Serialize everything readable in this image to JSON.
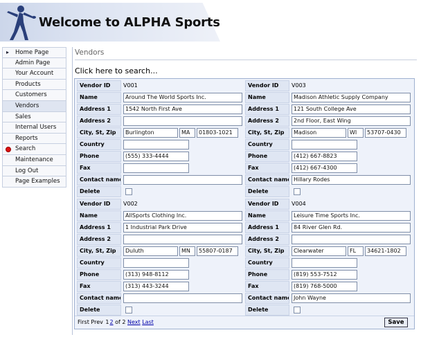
{
  "header": {
    "title_pre": "Welcome to ",
    "title_brand": "ALPHA",
    "title_post": " Sports"
  },
  "sidebar": {
    "items": [
      {
        "label": "Home Page",
        "marker": "arrow"
      },
      {
        "label": "Admin Page"
      },
      {
        "label": "Your Account"
      },
      {
        "label": "Products"
      },
      {
        "label": "Customers"
      },
      {
        "label": "Vendors",
        "active": true
      },
      {
        "label": "Sales"
      },
      {
        "label": "Internal Users"
      },
      {
        "label": "Reports"
      },
      {
        "label": "Search",
        "marker": "red-dot"
      },
      {
        "label": "Maintenance"
      },
      {
        "label": "Log Out"
      },
      {
        "label": "Page Examples"
      }
    ]
  },
  "main": {
    "heading": "Vendors",
    "search_link": "Click here to search..."
  },
  "labels": {
    "vendor_id": "Vendor ID",
    "name": "Name",
    "address1": "Address 1",
    "address2": "Address 2",
    "city_st_zip": "City, St, Zip",
    "country": "Country",
    "phone": "Phone",
    "fax": "Fax",
    "contact_name": "Contact name",
    "delete": "Delete"
  },
  "vendors": [
    {
      "vendor_id": "V001",
      "name": "Around The World Sports Inc.",
      "address1": "1542 North First Ave",
      "address2": "",
      "city": "Burlington",
      "state": "MA",
      "zip": "01803-1021",
      "country": "",
      "phone": "(555) 333-4444",
      "fax": "",
      "contact_name": "",
      "delete": false
    },
    {
      "vendor_id": "V003",
      "name": "Madison Athletic Supply Company",
      "address1": "121 South College Ave",
      "address2": "2nd Floor, East Wing",
      "city": "Madison",
      "state": "WI",
      "zip": "53707-0430",
      "country": "",
      "phone": "(412) 667-8823",
      "fax": "(412) 667-4300",
      "contact_name": "Hillary Rodes",
      "delete": false
    },
    {
      "vendor_id": "V002",
      "name": "AllSports Clothing Inc.",
      "address1": "1 Industrial Park Drive",
      "address2": "",
      "city": "Duluth",
      "state": "MN",
      "zip": "55807-0187",
      "country": "",
      "phone": "(313) 948-8112",
      "fax": "(313) 443-3244",
      "contact_name": "",
      "delete": false
    },
    {
      "vendor_id": "V004",
      "name": "Leisure Time Sports Inc.",
      "address1": "84 River Glen Rd.",
      "address2": "",
      "city": "Clearwater",
      "state": "FL",
      "zip": "34621-1802",
      "country": "",
      "phone": "(819) 553-7512",
      "fax": "(819) 768-5000",
      "contact_name": "John Wayne",
      "delete": false
    }
  ],
  "pager": {
    "first": "First",
    "prev": "Prev",
    "page1": "1",
    "page2": "2",
    "of_text": "of 2",
    "next": "Next",
    "last": "Last"
  },
  "buttons": {
    "save": "Save"
  }
}
